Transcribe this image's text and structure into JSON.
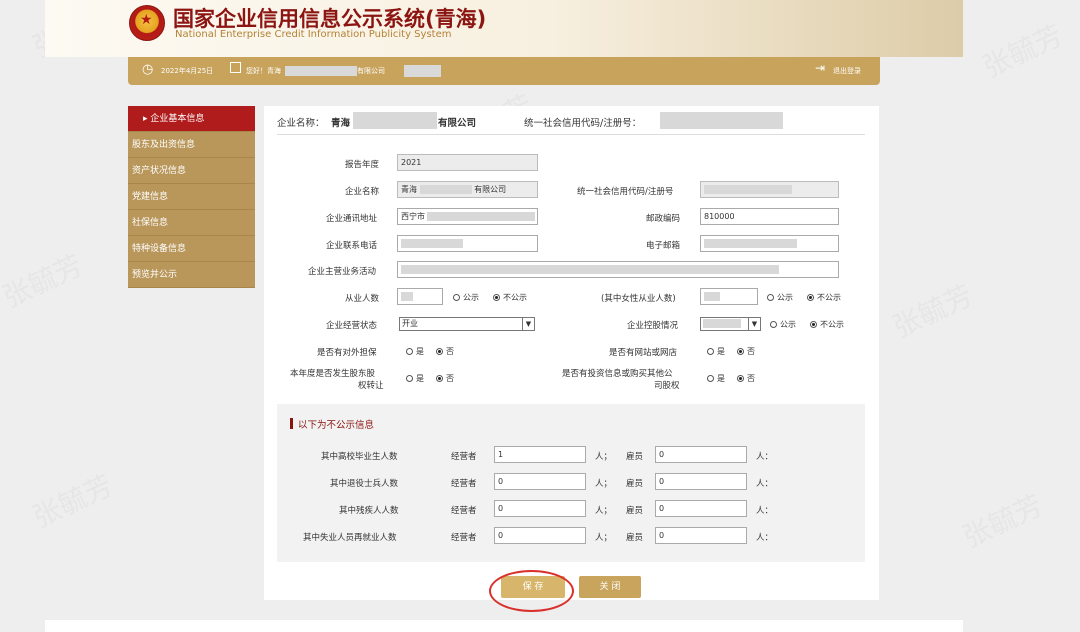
{
  "header": {
    "title": "国家企业信用信息公示系统(青海)",
    "subtitle": "National Enterprise Credit Information Publicity System"
  },
  "topbar": {
    "date": "2022年4月25日",
    "greeting": "您好！青海",
    "company_suffix": "有限公司",
    "logout": "退出登录"
  },
  "sidebar": {
    "items": [
      {
        "label": "企业基本信息",
        "active": true
      },
      {
        "label": "股东及出资信息",
        "active": false
      },
      {
        "label": "资产状况信息",
        "active": false
      },
      {
        "label": "党建信息",
        "active": false
      },
      {
        "label": "社保信息",
        "active": false
      },
      {
        "label": "特种设备信息",
        "active": false
      },
      {
        "label": "预览并公示",
        "active": false
      }
    ]
  },
  "company": {
    "name_label": "企业名称：",
    "name_prefix": "青海",
    "name_suffix": "有限公司",
    "code_label": "统一社会信用代码/注册号："
  },
  "form": {
    "report_year": {
      "label": "报告年度",
      "value": "2021"
    },
    "company_name": {
      "label": "企业名称",
      "prefix": "青海",
      "suffix": "有限公司"
    },
    "credit_code": {
      "label": "统一社会信用代码/注册号"
    },
    "address": {
      "label": "企业通讯地址",
      "value": "西宁市"
    },
    "postcode": {
      "label": "邮政编码",
      "value": "810000"
    },
    "phone": {
      "label": "企业联系电话"
    },
    "email": {
      "label": "电子邮箱"
    },
    "business": {
      "label": "企业主营业务活动"
    },
    "employees": {
      "label": "从业人数",
      "opt_public": "公示",
      "opt_private": "不公示"
    },
    "female": {
      "label": "(其中女性从业人数)",
      "opt_public": "公示",
      "opt_private": "不公示"
    },
    "status": {
      "label": "企业经营状态",
      "value": "开业"
    },
    "holding": {
      "label": "企业控股情况",
      "opt_public": "公示",
      "opt_private": "不公示"
    },
    "guarantee": {
      "label": "是否有对外担保",
      "yes": "是",
      "no": "否"
    },
    "website": {
      "label": "是否有网站或网店",
      "yes": "是",
      "no": "否"
    },
    "transfer": {
      "label_1": "本年度是否发生股东股",
      "label_2": "权转让",
      "yes": "是",
      "no": "否"
    },
    "invest": {
      "label_1": "是否有投资信息或购买其他公",
      "label_2": "司股权",
      "yes": "是",
      "no": "否"
    }
  },
  "nonpublic": {
    "title": "以下为不公示信息",
    "operator_label": "经营者",
    "employee_label": "雇员",
    "unit": "人；",
    "unit_end": "人：",
    "rows": [
      {
        "label": "其中高校毕业生人数",
        "operator": "1",
        "employee": "0"
      },
      {
        "label": "其中退役士兵人数",
        "operator": "0",
        "employee": "0"
      },
      {
        "label": "其中残疾人人数",
        "operator": "0",
        "employee": "0"
      },
      {
        "label": "其中失业人员再就业人数",
        "operator": "0",
        "employee": "0"
      }
    ]
  },
  "buttons": {
    "save": "保 存",
    "close": "关 闭"
  },
  "colors": {
    "gold": "#c7a35c",
    "red": "#b01c1c",
    "highlight": "#d9302c"
  },
  "watermark": "张毓芳"
}
